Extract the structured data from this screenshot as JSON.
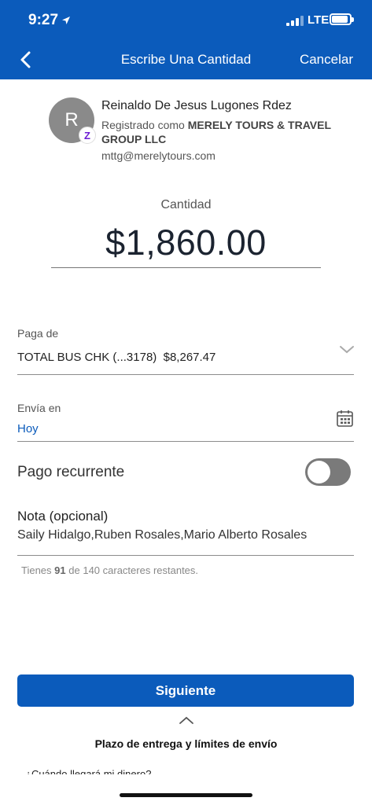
{
  "status_bar": {
    "time": "9:27",
    "network": "LTE"
  },
  "header": {
    "title": "Escribe Una Cantidad",
    "cancel_label": "Cancelar"
  },
  "recipient": {
    "initial": "R",
    "name": "Reinaldo De Jesus Lugones Rdez",
    "registered_prefix": "Registrado como",
    "registered_business": "MERELY TOURS & TRAVEL GROUP LLC",
    "email": "mttg@merelytours.com",
    "badge": "Z"
  },
  "amount": {
    "label": "Cantidad",
    "value": "$1,860.00"
  },
  "pay_from": {
    "label": "Paga de",
    "account": "TOTAL BUS CHK (...3178)",
    "balance": "$8,267.47"
  },
  "send_on": {
    "label": "Envía en",
    "value": "Hoy"
  },
  "recurring": {
    "label": "Pago recurrente",
    "enabled": false
  },
  "note": {
    "label": "Nota (opcional)",
    "value": "Saily Hidalgo,Ruben Rosales,Mario Alberto Rosales",
    "remaining_prefix": "Tienes",
    "remaining_count": "91",
    "remaining_suffix": "de 140 caracteres restantes."
  },
  "next_label": "Siguiente",
  "delivery": {
    "title": "Plazo de entrega y límites de envío",
    "question": "¿Cuándo llegará mi dinero?"
  },
  "colors": {
    "brand": "#0b5bbb",
    "zelle": "#6d1ed4",
    "toggle_off": "#7a7a7a"
  }
}
